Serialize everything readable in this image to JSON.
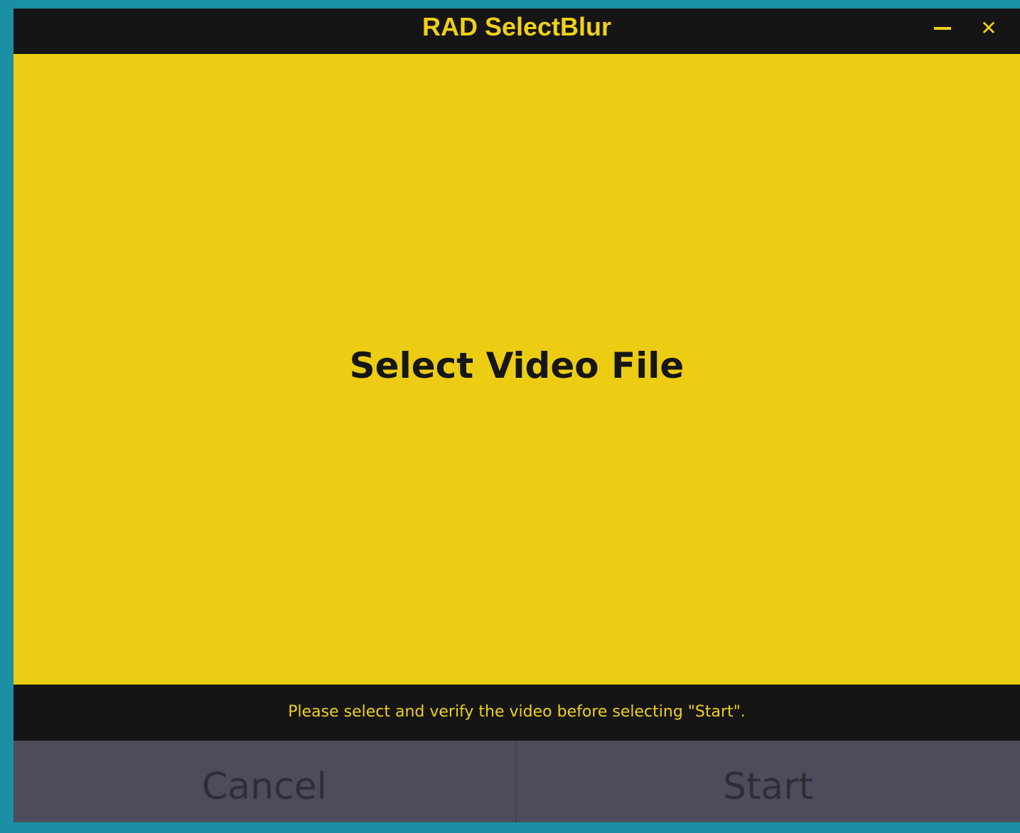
{
  "window": {
    "title": "RAD SelectBlur",
    "minimize_icon": "minimize-icon",
    "close_icon": "close-icon",
    "close_glyph": "✕"
  },
  "main": {
    "dropzone_label": "Select Video File"
  },
  "status": {
    "message": "Please select and verify the video before selecting \"Start\"."
  },
  "footer": {
    "cancel_label": "Cancel",
    "start_label": "Start"
  },
  "colors": {
    "accent": "#f0d01a",
    "background_teal": "#1b8fa3",
    "bar_black": "#151515",
    "footer_gray": "#4c4c5d"
  }
}
